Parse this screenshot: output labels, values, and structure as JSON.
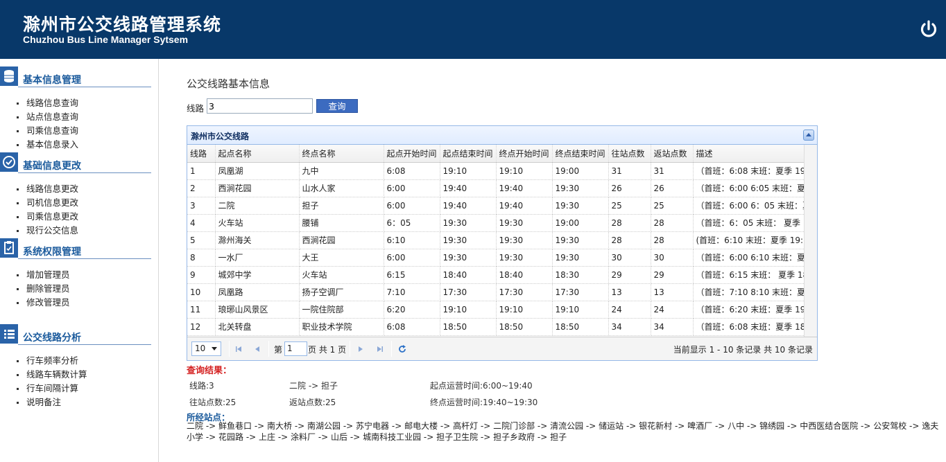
{
  "header": {
    "title_cn": "滁州市公交线路管理系统",
    "title_en": "Chuzhou Bus Line Manager Sytsem",
    "power_icon": "power-icon"
  },
  "sidebar": [
    {
      "title": "基本信息管理",
      "icon": "database-icon",
      "items": [
        "线路信息查询",
        "站点信息查询",
        "司乘信息查询",
        "基本信息录入"
      ]
    },
    {
      "title": "基础信息更改",
      "icon": "check-circle-icon",
      "items": [
        "线路信息更改",
        "司机信息更改",
        "司乘信息更改",
        "现行公交信息"
      ]
    },
    {
      "title": "系统权限管理",
      "icon": "clipboard-icon",
      "items": [
        "增加管理员",
        "删除管理员",
        "修改管理员"
      ]
    },
    {
      "title": "公交线路分析",
      "icon": "list-icon",
      "items": [
        "行车频率分析",
        "线路车辆数计算",
        "行车间隔计算",
        "说明备注"
      ]
    }
  ],
  "main": {
    "title": "公交线路基本信息",
    "search": {
      "label": "线路",
      "value": "3",
      "button": "查询"
    },
    "grid": {
      "title": "滁州市公交线路",
      "columns": [
        "线路",
        "起点名称",
        "终点名称",
        "起点开始时间",
        "起点结束时间",
        "终点开始时间",
        "终点结束时间",
        "往站点数",
        "返站点数",
        "描述"
      ],
      "rows": [
        [
          "1",
          "凤凰湖",
          "九中",
          "6:08",
          "19:10",
          "19:10",
          "19:00",
          "31",
          "31",
          "（首班：6:08 末班：夏季 19:"
        ],
        [
          "2",
          "西涧花园",
          "山水人家",
          "6:00",
          "19:40",
          "19:40",
          "19:30",
          "26",
          "26",
          "（首班：6:00 6:05 末班：夏季"
        ],
        [
          "3",
          "二院",
          "担子",
          "6:00",
          "19:40",
          "19:40",
          "19:30",
          "25",
          "25",
          "（首班：6:00 6：05 末班：夏"
        ],
        [
          "4",
          "火车站",
          "腰铺",
          "6：05",
          "19:30",
          "19:30",
          "19:00",
          "28",
          "28",
          "（首班：6：05 末班： 夏季 1"
        ],
        [
          "5",
          "滁州海关",
          "西涧花园",
          "6:10",
          "19:30",
          "19:30",
          "19:30",
          "28",
          "28",
          "(首班：6:10 末班：夏季 19:1"
        ],
        [
          "8",
          "一水厂",
          "大王",
          "6:00",
          "19:30",
          "19:30",
          "19:30",
          "30",
          "30",
          "（首班：6:00 6:10 末班：夏季"
        ],
        [
          "9",
          "城郊中学",
          "火车站",
          "6:15",
          "18:40",
          "18:40",
          "18:30",
          "29",
          "29",
          "（首班：6:15 末班： 夏季 18:"
        ],
        [
          "10",
          "凤凰路",
          "扬子空调厂",
          "7:10",
          "17:30",
          "17:30",
          "17:30",
          "13",
          "13",
          "（首班：7:10 8:10 末班：夏季"
        ],
        [
          "11",
          "琅琊山风景区",
          "一院住院部",
          "6:20",
          "19:10",
          "19:10",
          "19:10",
          "24",
          "24",
          "（首班：6:20 末班：夏季 19:"
        ],
        [
          "12",
          "北关转盘",
          "职业技术学院",
          "6:08",
          "18:50",
          "18:50",
          "18:50",
          "34",
          "34",
          "（首班：6:08 末班：夏季 18:"
        ]
      ],
      "pager": {
        "page_size": "10",
        "page_label": "第",
        "page": "1",
        "total_label": "页 共 1 页",
        "info": "当前显示 1 - 10 条记录 共 10 条记录"
      }
    },
    "result": {
      "title": "查询结果：",
      "line": "线路:3",
      "route": "二院 -> 担子",
      "start_time": "起点运营时间:6:00~19:40",
      "forward_stops": "往站点数:25",
      "return_stops": "返站点数:25",
      "end_time": "终点运营时间:19:40~19:30",
      "stops_title": "所经站点：",
      "stops": "二院 -> 鲜鱼巷口 -> 南大桥 -> 南湖公园 -> 苏宁电器 -> 邮电大楼 -> 高杆灯 -> 二院门诊部 -> 清流公园 -> 储运站 -> 银花新村 -> 啤酒厂 -> 八中 -> 锦绣园 -> 中西医结合医院 -> 公安驾校 -> 逸夫小学 -> 花园路 -> 上庄 -> 涂料厂 -> 山后 -> 城南科技工业园 -> 担子卫生院 -> 担子乡政府 -> 担子"
    }
  }
}
